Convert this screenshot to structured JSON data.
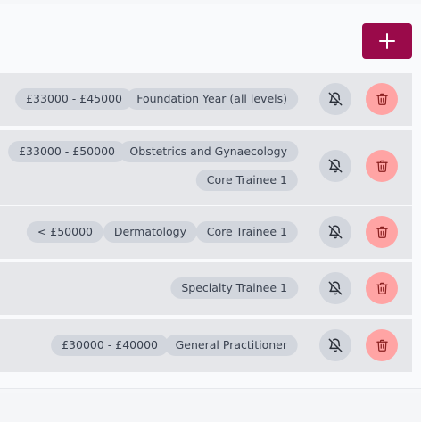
{
  "toolbar": {
    "add_button_icon": "plus-icon",
    "accent_color": "#9a0a4a"
  },
  "alerts": [
    {
      "salary": "£33000 - £45000",
      "specialty": "Foundation Year (all levels)",
      "grade": "",
      "mute_icon": "bell-off-icon",
      "delete_icon": "trash-icon"
    },
    {
      "salary": "£33000 - £50000",
      "specialty": "Obstetrics and Gynaecology",
      "grade": "Core Trainee 1",
      "mute_icon": "bell-off-icon",
      "delete_icon": "trash-icon"
    },
    {
      "salary": "< £50000",
      "specialty": "Dermatology",
      "grade": "Core Trainee 1",
      "mute_icon": "bell-off-icon",
      "delete_icon": "trash-icon"
    },
    {
      "salary": "",
      "specialty": "",
      "grade": "Specialty Trainee 1",
      "mute_icon": "bell-off-icon",
      "delete_icon": "trash-icon"
    },
    {
      "salary": "£30000 - £40000",
      "specialty": "General Practitioner",
      "grade": "",
      "mute_icon": "bell-off-icon",
      "delete_icon": "trash-icon"
    }
  ],
  "colors": {
    "tag_bg": "#d2d6dd",
    "mute_bg": "#d2d6dd",
    "delete_bg": "#ffa4a4",
    "row_bg": "#e6e7ea"
  }
}
